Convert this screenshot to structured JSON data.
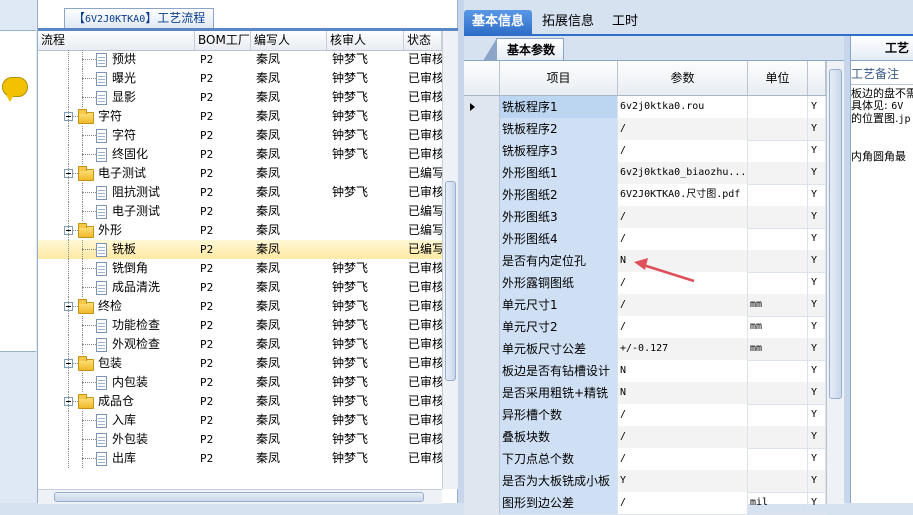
{
  "tree_panel": {
    "tab_prefix": "【",
    "tab_code": "6V2J0KTKA0",
    "tab_suffix": "】工艺流程",
    "columns": [
      "流程",
      "BOM工厂",
      "编写人",
      "核审人",
      "状态"
    ],
    "rows": [
      {
        "level": 2,
        "name": "预烘",
        "bom": "P2",
        "writer": "秦凤",
        "reviewer": "钟梦飞",
        "status": "已审核"
      },
      {
        "level": 2,
        "name": "曝光",
        "bom": "P2",
        "writer": "秦凤",
        "reviewer": "钟梦飞",
        "status": "已审核"
      },
      {
        "level": 2,
        "name": "显影",
        "bom": "P2",
        "writer": "秦凤",
        "reviewer": "钟梦飞",
        "status": "已审核"
      },
      {
        "level": 1,
        "name": "字符",
        "bom": "P2",
        "writer": "秦凤",
        "reviewer": "钟梦飞",
        "status": "已审核"
      },
      {
        "level": 2,
        "name": "字符",
        "bom": "P2",
        "writer": "秦凤",
        "reviewer": "钟梦飞",
        "status": "已审核"
      },
      {
        "level": 2,
        "name": "终固化",
        "bom": "P2",
        "writer": "秦凤",
        "reviewer": "钟梦飞",
        "status": "已审核"
      },
      {
        "level": 1,
        "name": "电子测试",
        "bom": "P2",
        "writer": "秦凤",
        "reviewer": "",
        "status": "已编写"
      },
      {
        "level": 2,
        "name": "阻抗测试",
        "bom": "P2",
        "writer": "秦凤",
        "reviewer": "钟梦飞",
        "status": "已审核"
      },
      {
        "level": 2,
        "name": "电子测试",
        "bom": "P2",
        "writer": "秦凤",
        "reviewer": "",
        "status": "已编写"
      },
      {
        "level": 1,
        "name": "外形",
        "bom": "P2",
        "writer": "秦凤",
        "reviewer": "",
        "status": "已编写"
      },
      {
        "level": 2,
        "name": "铣板",
        "bom": "P2",
        "writer": "秦凤",
        "reviewer": "",
        "status": "已编写",
        "selected": true
      },
      {
        "level": 2,
        "name": "铣倒角",
        "bom": "P2",
        "writer": "秦凤",
        "reviewer": "钟梦飞",
        "status": "已审核"
      },
      {
        "level": 2,
        "name": "成品清洗",
        "bom": "P2",
        "writer": "秦凤",
        "reviewer": "钟梦飞",
        "status": "已审核"
      },
      {
        "level": 1,
        "name": "终检",
        "bom": "P2",
        "writer": "秦凤",
        "reviewer": "钟梦飞",
        "status": "已审核"
      },
      {
        "level": 2,
        "name": "功能检查",
        "bom": "P2",
        "writer": "秦凤",
        "reviewer": "钟梦飞",
        "status": "已审核"
      },
      {
        "level": 2,
        "name": "外观检查",
        "bom": "P2",
        "writer": "秦凤",
        "reviewer": "钟梦飞",
        "status": "已审核"
      },
      {
        "level": 1,
        "name": "包装",
        "bom": "P2",
        "writer": "秦凤",
        "reviewer": "钟梦飞",
        "status": "已审核"
      },
      {
        "level": 2,
        "name": "内包装",
        "bom": "P2",
        "writer": "秦凤",
        "reviewer": "钟梦飞",
        "status": "已审核"
      },
      {
        "level": 1,
        "name": "成品仓",
        "bom": "P2",
        "writer": "秦凤",
        "reviewer": "钟梦飞",
        "status": "已审核"
      },
      {
        "level": 2,
        "name": "入库",
        "bom": "P2",
        "writer": "秦凤",
        "reviewer": "钟梦飞",
        "status": "已审核"
      },
      {
        "level": 2,
        "name": "外包装",
        "bom": "P2",
        "writer": "秦凤",
        "reviewer": "钟梦飞",
        "status": "已审核"
      },
      {
        "level": 2,
        "name": "出库",
        "bom": "P2",
        "writer": "秦凤",
        "reviewer": "钟梦飞",
        "status": "已审核"
      }
    ]
  },
  "right_panel": {
    "tabs": [
      {
        "label": "基本信息",
        "active": true
      },
      {
        "label": "拓展信息",
        "active": false
      },
      {
        "label": "工时",
        "active": false
      }
    ],
    "subtab": "基本参数",
    "grid_columns": [
      "项目",
      "参数",
      "单位"
    ],
    "params": [
      {
        "label": "铣板程序1",
        "value": "6v2j0ktka0.rou",
        "unit": "",
        "flag": "Y",
        "current": true
      },
      {
        "label": "铣板程序2",
        "value": "/",
        "unit": "",
        "flag": "Y"
      },
      {
        "label": "铣板程序3",
        "value": "/",
        "unit": "",
        "flag": "Y"
      },
      {
        "label": "外形图纸1",
        "value": "6v2j0ktka0_biaozhu...",
        "unit": "",
        "flag": "Y"
      },
      {
        "label": "外形图纸2",
        "value": "6V2J0KTKA0.尺寸图.pdf",
        "unit": "",
        "flag": "Y"
      },
      {
        "label": "外形图纸3",
        "value": "/",
        "unit": "",
        "flag": "Y"
      },
      {
        "label": "外形图纸4",
        "value": "/",
        "unit": "",
        "flag": "Y"
      },
      {
        "label": "是否有内定位孔",
        "value": "N",
        "unit": "",
        "flag": "Y"
      },
      {
        "label": "外形露铜图纸",
        "value": "/",
        "unit": "",
        "flag": "Y"
      },
      {
        "label": "单元尺寸1",
        "value": "/",
        "unit": "mm",
        "flag": "Y"
      },
      {
        "label": "单元尺寸2",
        "value": "/",
        "unit": "mm",
        "flag": "Y"
      },
      {
        "label": "单元板尺寸公差",
        "value": "+/-0.127",
        "unit": "mm",
        "flag": "Y"
      },
      {
        "label": "板边是否有钻槽设计",
        "value": "N",
        "unit": "",
        "flag": "Y"
      },
      {
        "label": "是否采用粗铣+精铣",
        "value": "N",
        "unit": "",
        "flag": "Y"
      },
      {
        "label": "异形槽个数",
        "value": "/",
        "unit": "",
        "flag": "Y"
      },
      {
        "label": "叠板块数",
        "value": "/",
        "unit": "",
        "flag": "Y"
      },
      {
        "label": "下刀点总个数",
        "value": "/",
        "unit": "",
        "flag": "Y"
      },
      {
        "label": "是否为大板铣成小板",
        "value": "Y",
        "unit": "",
        "flag": "Y"
      },
      {
        "label": "图形到边公差",
        "value": "/",
        "unit": "mil",
        "flag": "Y"
      }
    ],
    "notes": {
      "title": "工艺",
      "header": "工艺备注",
      "line1": "板边的盘不需",
      "line2_prefix": "具体见: ",
      "line2_code": "6V",
      "line3_prefix": "的位置图.",
      "line3_code": "jp",
      "line4": "内角圆角最"
    },
    "annotation_color": "#e0505a"
  }
}
